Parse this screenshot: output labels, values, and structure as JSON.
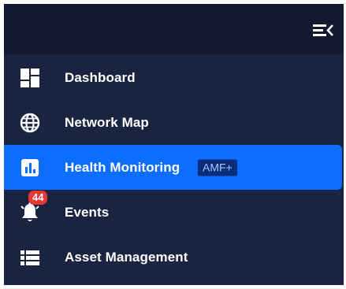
{
  "header": {
    "collapse_icon": "menu-collapse-icon"
  },
  "menu": {
    "items": [
      {
        "label": "Dashboard",
        "icon": "dashboard-icon"
      },
      {
        "label": "Network Map",
        "icon": "globe-icon"
      },
      {
        "label": "Health Monitoring",
        "icon": "bar-chart-icon",
        "badge": "AMF+",
        "active": true
      },
      {
        "label": "Events",
        "icon": "bell-icon",
        "count": "44"
      },
      {
        "label": "Asset Management",
        "icon": "list-icon"
      }
    ]
  },
  "colors": {
    "sidebar_bg": "#1a2340",
    "topbar_bg": "#131a30",
    "active_bg": "#0d6efd",
    "badge_bg": "#0b2c7a",
    "count_bg": "#e53935"
  }
}
